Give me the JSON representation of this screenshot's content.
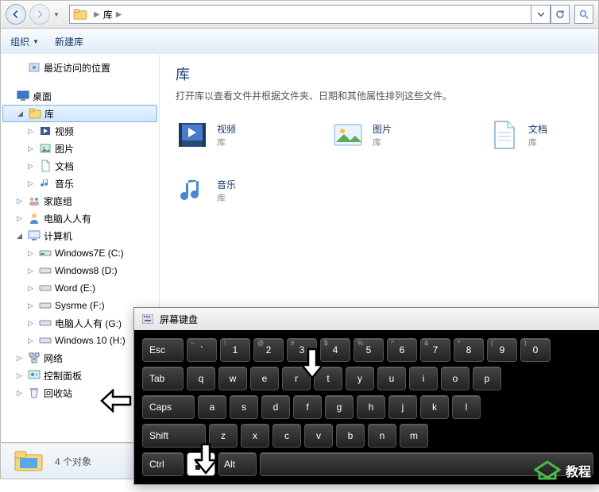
{
  "nav": {
    "crumb": "库"
  },
  "toolbar": {
    "organize": "组织",
    "newlib": "新建库"
  },
  "sidebar": {
    "recent": "最近访问的位置",
    "desktop": "桌面",
    "library": "库",
    "video": "视频",
    "pictures": "图片",
    "documents": "文档",
    "music": "音乐",
    "homegroup": "家庭组",
    "user": "电脑人人有",
    "computer": "计算机",
    "drives": [
      "Windows7E (C:)",
      "Windows8 (D:)",
      "Word (E:)",
      "Sysrme (F:)",
      "电脑人人有 (G:)",
      "Windows 10 (H:)"
    ],
    "network": "网络",
    "control": "控制面板",
    "recycle": "回收站"
  },
  "content": {
    "title": "库",
    "desc": "打开库以查看文件并根据文件夹、日期和其他属性排列这些文件。",
    "items": [
      {
        "name": "视频",
        "sub": "库"
      },
      {
        "name": "图片",
        "sub": "库"
      },
      {
        "name": "文档",
        "sub": "库"
      },
      {
        "name": "音乐",
        "sub": "库"
      }
    ]
  },
  "status": {
    "count": "4 个对象"
  },
  "osk": {
    "title": "屏幕键盘",
    "esc": "Esc",
    "tab": "Tab",
    "caps": "Caps",
    "shift": "Shift",
    "ctrl": "Ctrl",
    "alt": "Alt",
    "row1_sup": [
      "~",
      "!",
      "@",
      "#",
      "$",
      "%",
      "^",
      "&",
      "*",
      "(",
      ")"
    ],
    "row1": [
      "`",
      "1",
      "2",
      "3",
      "4",
      "5",
      "6",
      "7",
      "8",
      "9",
      "0"
    ],
    "row2": [
      "q",
      "w",
      "e",
      "r",
      "t",
      "y",
      "u",
      "i",
      "o",
      "p"
    ],
    "row3": [
      "a",
      "s",
      "d",
      "f",
      "g",
      "h",
      "j",
      "k",
      "l"
    ],
    "row4": [
      "z",
      "x",
      "c",
      "v",
      "b",
      "n",
      "m"
    ]
  },
  "watermark": "教程"
}
